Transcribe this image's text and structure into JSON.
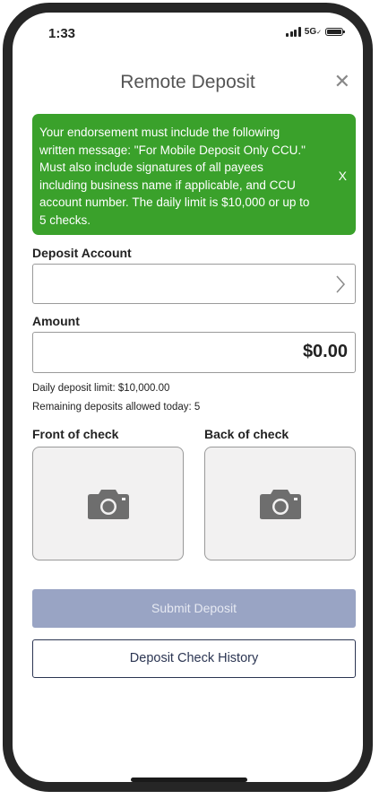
{
  "status_bar": {
    "time": "1:33",
    "network": "5G",
    "network_suffix": "✓"
  },
  "header": {
    "title": "Remote Deposit",
    "close_icon": "close-icon",
    "close_glyph": "✕"
  },
  "banner": {
    "message": "Your endorsement must include the following written message: \"For Mobile Deposit Only CCU.\" Must also include signatures of all payees including business name if applicable, and CCU account number. The daily limit is $10,000 or up to 5 checks.",
    "dismiss_label": "X",
    "color": "#3aa12b"
  },
  "deposit_account": {
    "label": "Deposit Account",
    "value": "",
    "chevron_glyph": "›"
  },
  "amount": {
    "label": "Amount",
    "value": "$0.00"
  },
  "limits": {
    "daily_limit": "Daily deposit limit: $10,000.00",
    "remaining": "Remaining deposits allowed today: 5"
  },
  "check_images": {
    "front_label": "Front of check",
    "back_label": "Back of check",
    "icon": "camera-icon"
  },
  "actions": {
    "submit_label": "Submit Deposit",
    "submit_color": "#99a4c4",
    "history_label": "Deposit Check History",
    "history_color": "#2b3552"
  }
}
